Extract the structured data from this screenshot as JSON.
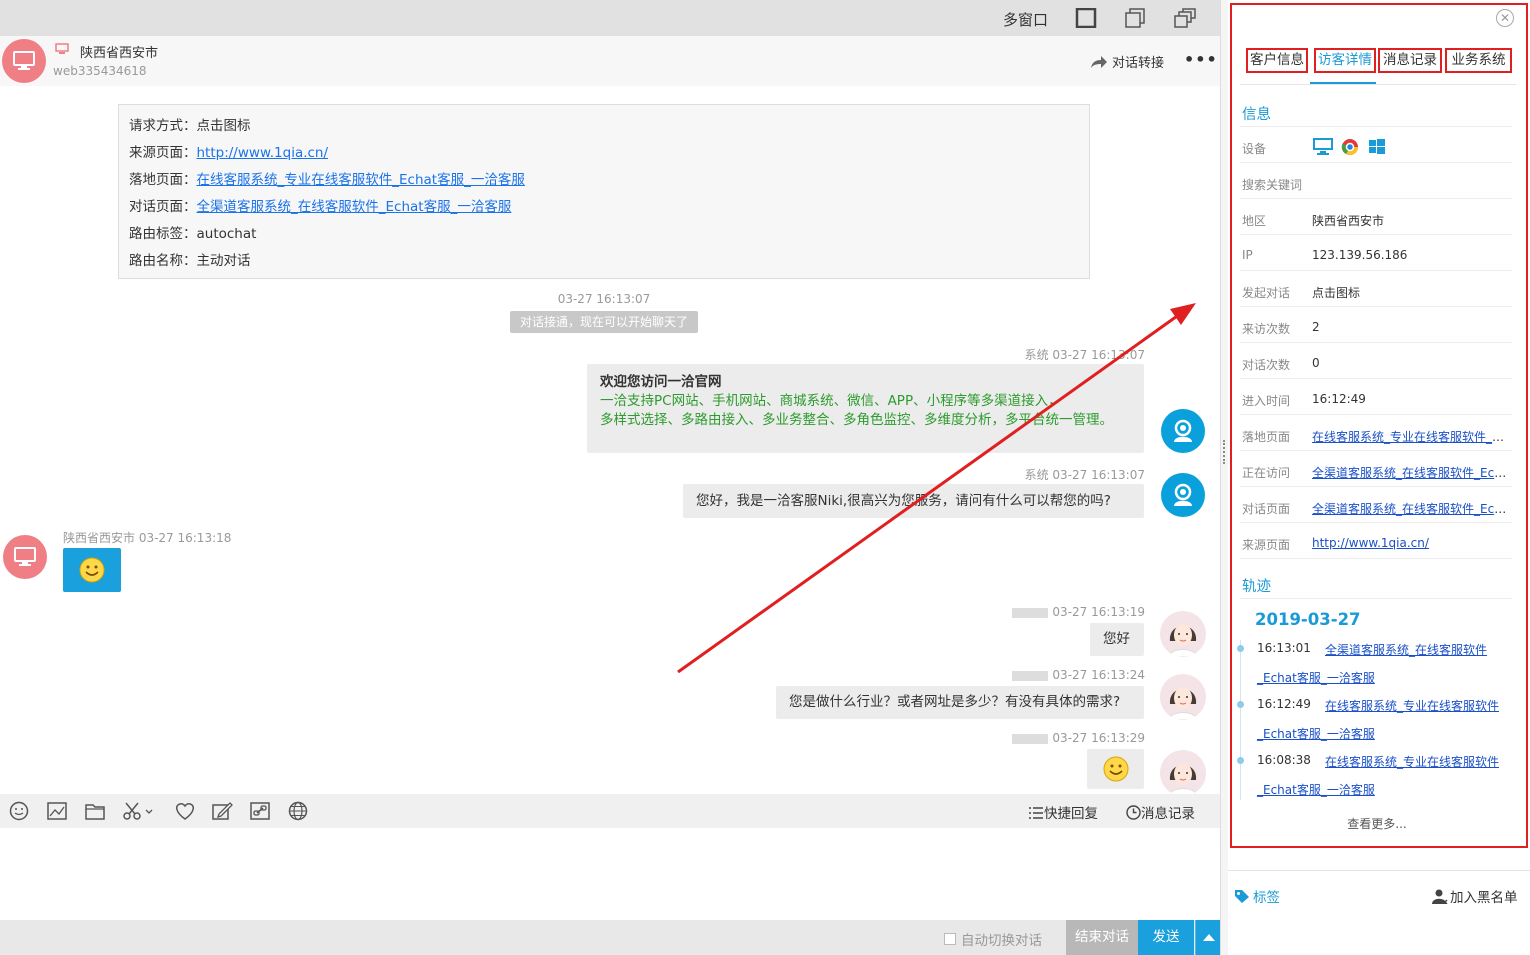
{
  "topbar": {
    "multi_window": "多窗口"
  },
  "chat_header": {
    "location": "陕西省西安市",
    "visitor_id": "web335434618",
    "transfer_label": "对话转接",
    "more_label": "•••"
  },
  "info_box": {
    "rows": [
      {
        "key": "请求方式：",
        "value": "点击图标"
      },
      {
        "key": "来源页面：",
        "value": "http://www.1qia.cn/"
      },
      {
        "key": "落地页面：",
        "value": "在线客服系统_专业在线客服软件_Echat客服_一洽客服"
      },
      {
        "key": "对话页面：",
        "value": "全渠道客服系统_在线客服软件_Echat客服_一洽客服"
      },
      {
        "key": "路由标签：",
        "value": "autochat"
      },
      {
        "key": "路由名称：",
        "value": "主动对话"
      }
    ]
  },
  "messages": {
    "connect_time": "03-27 16:13:07",
    "connect_note": "对话接通，现在可以开始聊天了",
    "welcome_meta": "系统 03-27 16:13:07",
    "welcome_title": "欢迎您访问一洽官网",
    "welcome_line1": "一洽支持PC网站、手机网站、商城系统、微信、APP、小程序等多渠道接入，",
    "welcome_line2": "多样式选择、多路由接入、多业务整合、多角色监控、多维度分析，多平台统一管理。",
    "greet_meta": "系统 03-27 16:13:07",
    "greet_text": "您好，我是一洽客服Niki,很高兴为您服务，请问有什么可以帮您的吗?",
    "visitor_meta": "陕西省西安市 03-27 16:13:18",
    "agent1_time": "03-27 16:13:19",
    "agent1_text": "您好",
    "agent2_time": "03-27 16:13:24",
    "agent2_text": "您是做什么行业？或者网址是多少？有没有具体的需求?",
    "agent3_time": "03-27 16:13:29"
  },
  "toolbar": {
    "quick_reply": "快捷回复",
    "message_log": "消息记录"
  },
  "bottom": {
    "auto_switch": "自动切换对话",
    "end_chat": "结束对话",
    "send": "发送"
  },
  "right_panel": {
    "tabs": [
      "客户信息",
      "访客详情",
      "消息记录",
      "业务系统"
    ],
    "info_title": "信息",
    "rows": [
      {
        "key": "设备",
        "value": ""
      },
      {
        "key": "搜索关键词",
        "value": ""
      },
      {
        "key": "地区",
        "value": "陕西省西安市"
      },
      {
        "key": "IP",
        "value": "123.139.56.186"
      },
      {
        "key": "发起对话",
        "value": "点击图标"
      },
      {
        "key": "来访次数",
        "value": "2"
      },
      {
        "key": "对话次数",
        "value": "0"
      },
      {
        "key": "进入时间",
        "value": "16:12:49"
      },
      {
        "key": "落地页面",
        "value": "在线客服系统_专业在线客服软件_E..."
      },
      {
        "key": "正在访问",
        "value": "全渠道客服系统_在线客服软件_Ech..."
      },
      {
        "key": "对话页面",
        "value": "全渠道客服系统_在线客服软件_Ech..."
      },
      {
        "key": "来源页面",
        "value": "http://www.1qia.cn/"
      }
    ],
    "track_title": "轨迹",
    "track_date": "2019-03-27",
    "track": [
      {
        "time": "16:13:01",
        "line1": "全渠道客服系统_在线客服软件",
        "line2": "_Echat客服_一洽客服"
      },
      {
        "time": "16:12:49",
        "line1": "在线客服系统_专业在线客服软件",
        "line2": "_Echat客服_一洽客服"
      },
      {
        "time": "16:08:38",
        "line1": "在线客服系统_专业在线客服软件",
        "line2": "_Echat客服_一洽客服"
      }
    ],
    "see_more": "查看更多...",
    "tags_label": "标签",
    "blacklist_label": "加入黑名单"
  },
  "colors": {
    "accent": "#1a9ad6",
    "annotation_red": "#e02020",
    "visitor_pink": "#f07f85",
    "system_blue": "#0aa0dc"
  }
}
